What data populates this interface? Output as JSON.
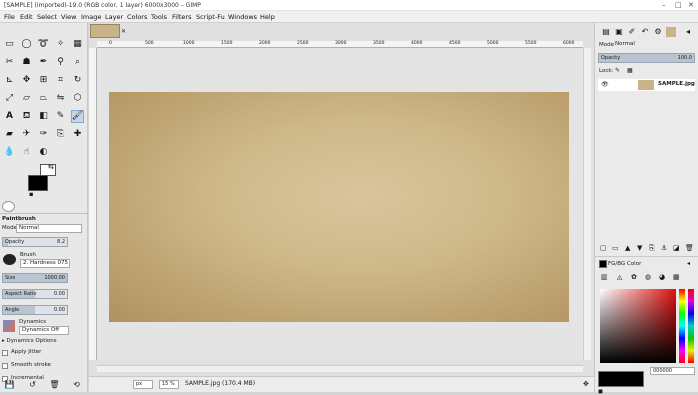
{
  "window": {
    "title": "[SAMPLE] (imported)-19.0 (RGB color, 1 layer) 6000x3000 – GIMP",
    "minimize": "–",
    "maximize": "□",
    "close": "✕"
  },
  "menubar": [
    "File",
    "Edit",
    "Select",
    "View",
    "Image",
    "Layer",
    "Colors",
    "Tools",
    "Filters",
    "Script-Fu",
    "Windows",
    "Help"
  ],
  "tool_options": {
    "tool_name": "Paintbrush",
    "mode_label": "Mode",
    "mode_value": "Normal",
    "opacity_label": "Opacity",
    "opacity_value": "8.2",
    "brush_label": "Brush",
    "brush_value": "2. Hardness 075",
    "size_label": "Size",
    "size_value": "1000.00",
    "aspect_label": "Aspect Ratio",
    "aspect_value": "0.00",
    "angle_label": "Angle",
    "angle_value": "0.00",
    "dynamics_label": "Dynamics",
    "dynamics_value": "Dynamics Off",
    "dynamics_options": "Dynamics Options",
    "apply_jitter": "Apply Jitter",
    "smooth_stroke": "Smooth stroke",
    "incremental": "Incremental"
  },
  "ruler_ticks": [
    "0",
    "500",
    "1000",
    "1500",
    "2000",
    "2500",
    "3000",
    "3500",
    "4000",
    "4500",
    "5000",
    "5500",
    "6000"
  ],
  "status": {
    "unit": "px",
    "zoom": "15 %",
    "info": "SAMPLE.jpg (170.4 MB)"
  },
  "layers_panel": {
    "mode_label": "Mode",
    "mode_value": "Normal",
    "opacity_label": "Opacity",
    "opacity_value": "100.0",
    "lock_label": "Lock:",
    "layer_name": "SAMPLE.jpg"
  },
  "color_panel": {
    "title": "FG/BG Color",
    "hex_value": "000000"
  },
  "colors": {
    "fg": "#000000",
    "bg": "#ffffff",
    "accent": "#8aa8cc"
  }
}
